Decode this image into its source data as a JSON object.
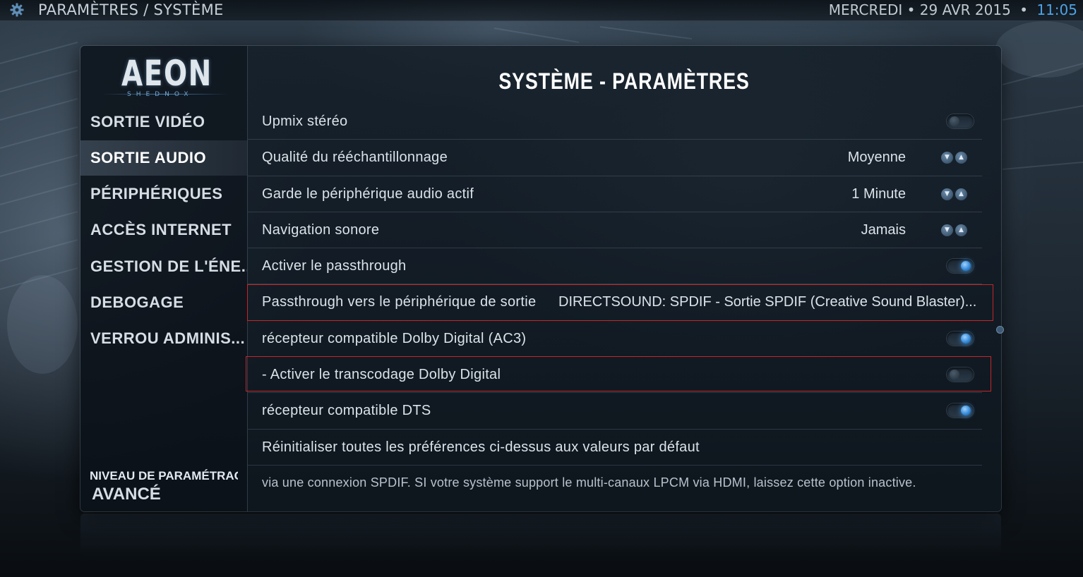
{
  "topbar": {
    "breadcrumb": "PARAMÈTRES / SYSTÈME",
    "date": "MERCREDI • 29 AVR 2015",
    "separator": "•",
    "time": "11:05"
  },
  "logo": {
    "main": "AEON",
    "sub": "SHEDNOX"
  },
  "sidebar": {
    "items": [
      {
        "label": "SORTIE VIDÉO"
      },
      {
        "label": "SORTIE AUDIO"
      },
      {
        "label": "PÉRIPHÉRIQUES"
      },
      {
        "label": "ACCÈS INTERNET"
      },
      {
        "label": "GESTION DE L'ÉNE..."
      },
      {
        "label": "DEBOGAGE"
      },
      {
        "label": "VERROU ADMINIS..."
      }
    ],
    "selected_index": 1,
    "level_label": "NIVEAU DE PARAMÉTRAGE",
    "level_value": "AVANCÉ"
  },
  "main": {
    "title": "SYSTÈME - PARAMÈTRES",
    "rows": [
      {
        "label": "Upmix stéréo",
        "control": "toggle",
        "state": "off"
      },
      {
        "label": "Qualité du rééchantillonnage",
        "value": "Moyenne",
        "control": "spinner"
      },
      {
        "label": "Garde le périphérique audio actif",
        "value": "1 Minute",
        "control": "spinner"
      },
      {
        "label": "Navigation sonore",
        "value": "Jamais",
        "control": "spinner"
      },
      {
        "label": "Activer le passthrough",
        "control": "toggle",
        "state": "on"
      },
      {
        "label": "Passthrough vers le périphérique de sortie",
        "value": "DIRECTSOUND: SPDIF - Sortie SPDIF (Creative Sound Blaster)...",
        "control": "value",
        "highlighted": true
      },
      {
        "label": "récepteur compatible Dolby Digital (AC3)",
        "control": "toggle",
        "state": "on"
      },
      {
        "label": "- Activer le transcodage Dolby Digital",
        "control": "toggle",
        "state": "off",
        "highlighted": true
      },
      {
        "label": "récepteur compatible DTS",
        "control": "toggle",
        "state": "on"
      },
      {
        "label": "Réinitialiser toutes les préférences ci-dessus aux valeurs par défaut",
        "control": "action"
      }
    ],
    "description": "via une connexion SPDIF. SI votre système support le multi-canaux LPCM via HDMI, laissez cette option inactive."
  },
  "colors": {
    "accent": "#4da3e6",
    "highlight_box": "#c3262a",
    "toggle_on": "#2f86d6"
  },
  "icons": {
    "settings": "gear-icon",
    "spinner_down": "chevron-down-icon",
    "spinner_up": "chevron-up-icon"
  }
}
